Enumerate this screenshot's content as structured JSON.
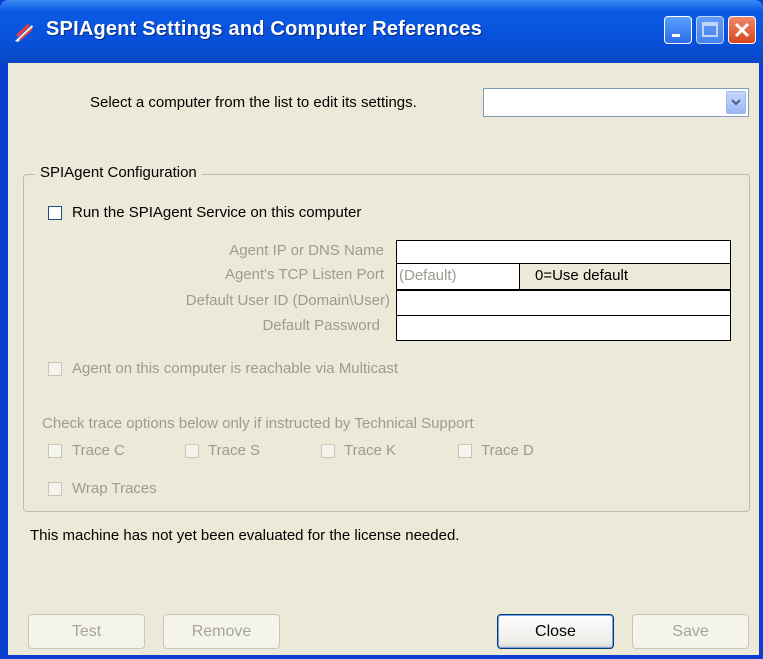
{
  "window": {
    "title": "SPIAgent Settings and Computer References"
  },
  "computer_select": {
    "label": "Select a computer from the list to edit its settings.",
    "value": ""
  },
  "config_group": {
    "title": "SPIAgent Configuration",
    "run_service_label": "Run the SPIAgent Service on this computer",
    "agent_ip_label": "Agent IP or DNS Name",
    "agent_ip_value": "",
    "tcp_port_label": "Agent's TCP Listen Port",
    "tcp_port_placeholder": "(Default)",
    "tcp_port_hint": "0=Use default",
    "user_id_label": "Default User ID (Domain\\User)",
    "user_id_value": "",
    "password_label": "Default Password",
    "password_value": "",
    "multicast_label": "Agent on this computer is reachable via Multicast",
    "trace_instructions": "Check trace options below only if instructed by Technical Support",
    "trace_options": [
      "Trace C",
      "Trace S",
      "Trace K",
      "Trace D"
    ],
    "wrap_traces_label": "Wrap Traces"
  },
  "license_status": "This machine has not yet been evaluated for the license needed.",
  "buttons": {
    "test": "Test",
    "remove": "Remove",
    "close": "Close",
    "save": "Save"
  }
}
